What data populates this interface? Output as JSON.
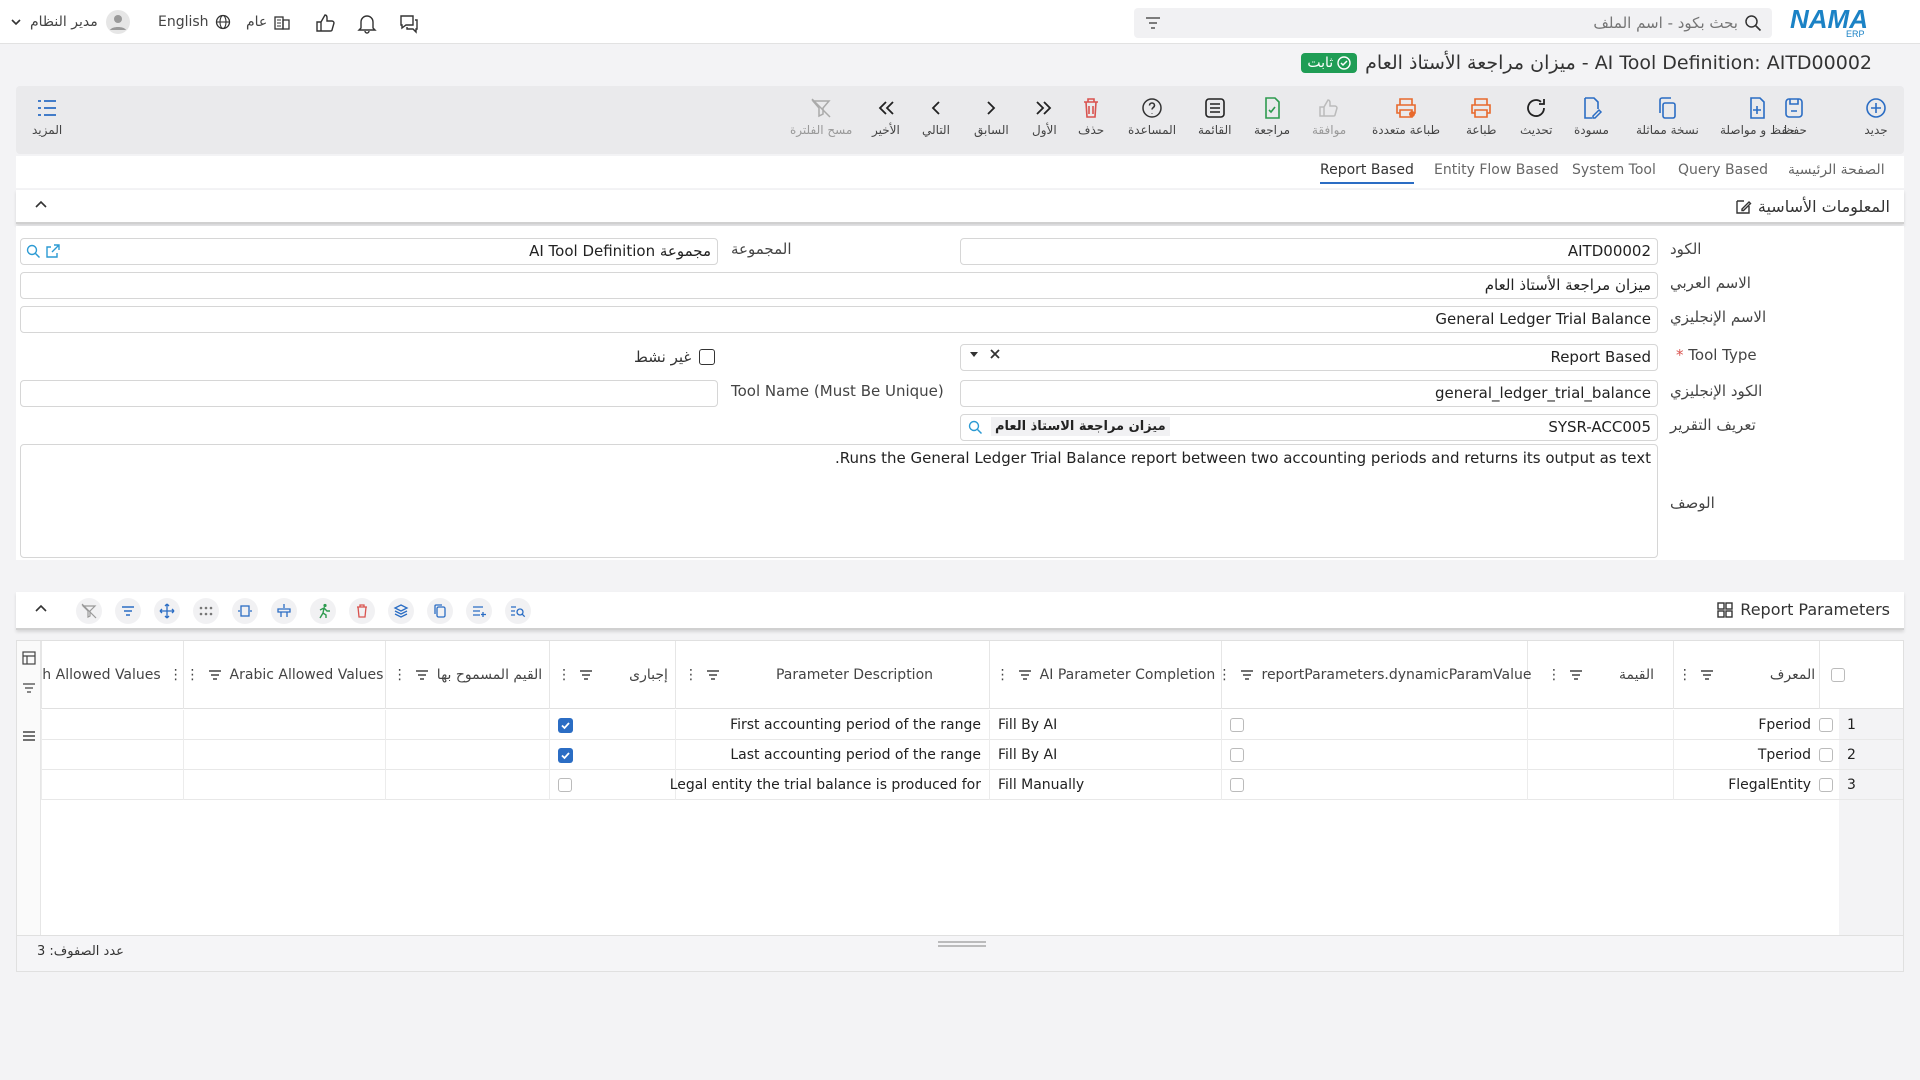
{
  "topbar": {
    "user_label": "مدير النظام",
    "language": "English",
    "general_label": "عام",
    "search_placeholder": "بحث بكود - اسم الملف",
    "logo_text": "NAMA",
    "logo_sub": "ERP"
  },
  "title": {
    "badge": "ثابت",
    "text": "AI Tool Definition: AITD00002 - ميزان مراجعة الأستاذ العام"
  },
  "toolbar": {
    "more": "المزيد",
    "clear_filter": "مسح الفلترة",
    "last": "الأخير",
    "next": "التالي",
    "previous": "السابق",
    "first": "الأول",
    "delete": "حذف",
    "help": "المساعدة",
    "list": "القائمة",
    "review": "مراجعة",
    "approve": "موافقة",
    "multi_print": "طباعة متعددة",
    "print": "طباعة",
    "refresh": "تحديث",
    "draft": "مسودة",
    "duplicate": "نسخة مماثلة",
    "save_continue": "حفظ و مواصلة",
    "save": "حفظ",
    "new": "جديد"
  },
  "tabs": [
    "Report Based",
    "Entity Flow Based",
    "System Tool",
    "Query Based",
    "الصفحة الرئيسية"
  ],
  "basic_info": {
    "section_title": "المعلومات الأساسية",
    "code_label": "الكود",
    "code_value": "AITD00002",
    "group_label": "المجموعة",
    "group_value": "مجموعة AI Tool Definition",
    "arabic_name_label": "الاسم العربي",
    "arabic_name_value": "ميزان مراجعة الأستاذ العام",
    "english_name_label": "الاسم الإنجليزي",
    "english_name_value": "General Ledger Trial Balance",
    "tool_type_label": "Tool Type",
    "tool_type_value": "Report Based",
    "inactive_label": "غير نشط",
    "english_code_label": "الكود الإنجليزي",
    "english_code_value": "general_ledger_trial_balance",
    "tool_name_label": "Tool Name (Must Be Unique)",
    "tool_name_value": "",
    "report_def_label": "تعريف التقرير",
    "report_def_code": "SYSR-ACC005",
    "report_def_name": "ميزان مراجعة الاستاذ العام",
    "description_label": "الوصف",
    "description_value": "Runs the General Ledger Trial Balance report between two accounting periods and returns its output as text."
  },
  "params": {
    "section_title": "Report Parameters",
    "columns": {
      "id": "المعرف",
      "value": "القيمة",
      "dynamic": "reportParameters.dynamicParamValue",
      "completion": "AI Parameter Completion",
      "description": "Parameter Description",
      "required": "إجبارى",
      "allowed": "القيم المسموح بها",
      "arabic_allowed": "Arabic Allowed Values",
      "english_allowed": "h Allowed Values"
    },
    "rows": [
      {
        "num": "1",
        "id": "Fperiod",
        "completion": "Fill By AI",
        "description": "First accounting period of the range",
        "required": true
      },
      {
        "num": "2",
        "id": "Tperiod",
        "completion": "Fill By AI",
        "description": "Last accounting period of the range",
        "required": true
      },
      {
        "num": "3",
        "id": "FlegalEntity",
        "completion": "Fill Manually",
        "description": "Legal entity the trial balance is produced for",
        "required": false
      }
    ],
    "row_count": "عدد الصفوف: 3"
  },
  "colors": {
    "accent": "#2b6dc4",
    "badge": "#1f9d55",
    "danger": "#d9534f",
    "green": "#2e9b4f",
    "orange": "#e8692c"
  }
}
